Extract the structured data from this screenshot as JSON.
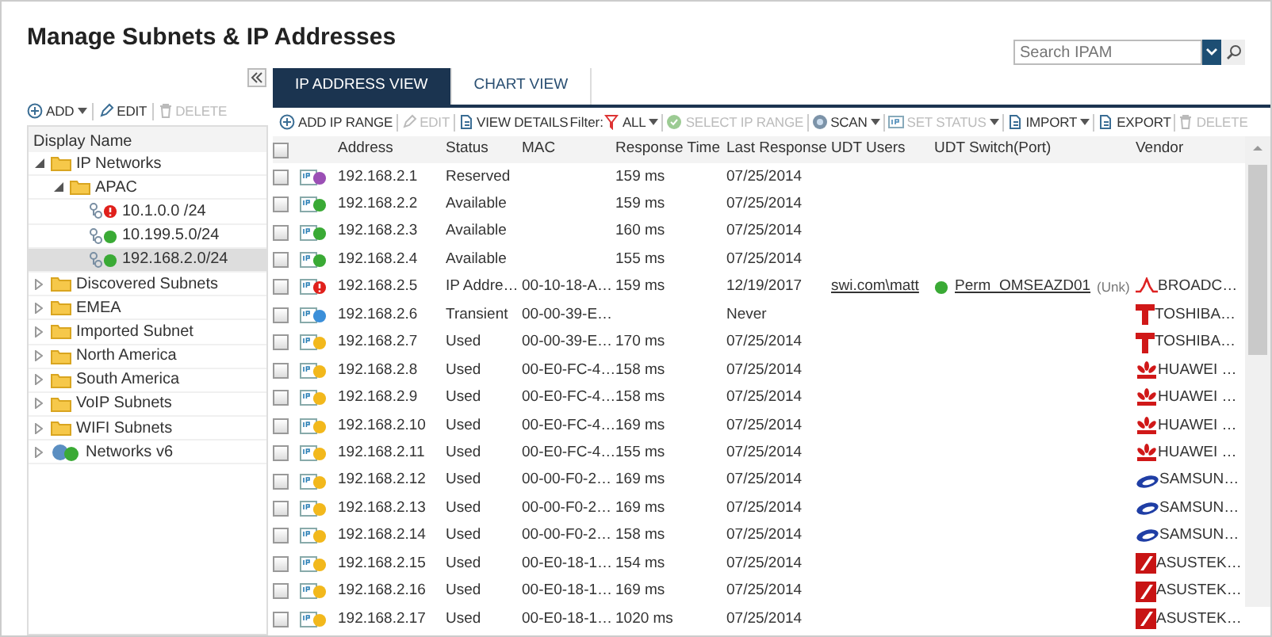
{
  "page_title": "Manage Subnets & IP Addresses",
  "search": {
    "placeholder": "Search IPAM"
  },
  "tree_toolbar": [
    {
      "label": "ADD",
      "dropdown": true,
      "disabled": false
    },
    {
      "label": "EDIT",
      "dropdown": false,
      "disabled": false
    },
    {
      "label": "DELETE",
      "dropdown": false,
      "disabled": true
    }
  ],
  "tree_header": "Display Name",
  "tree": [
    {
      "label": "IP Networks",
      "kind": "folder",
      "expanded": true,
      "selected": false,
      "children": [
        {
          "label": "APAC",
          "kind": "folder",
          "expanded": true,
          "selected": false,
          "children": [
            {
              "label": "10.1.0.0 /24",
              "kind": "subnet",
              "selected": false,
              "color": "#e0201b",
              "alert": true
            },
            {
              "label": "10.199.5.0/24",
              "kind": "subnet",
              "selected": false,
              "color": "#3aaa35",
              "alert": false
            },
            {
              "label": "192.168.2.0/24",
              "kind": "subnet",
              "selected": true,
              "color": "#3aaa35",
              "alert": false
            }
          ]
        }
      ]
    },
    {
      "label": "Discovered Subnets",
      "kind": "folder",
      "expanded": false,
      "selected": false
    },
    {
      "label": "EMEA",
      "kind": "folder",
      "expanded": false,
      "selected": false
    },
    {
      "label": "Imported Subnet",
      "kind": "folder",
      "expanded": false,
      "selected": false
    },
    {
      "label": "North America",
      "kind": "folder",
      "expanded": false,
      "selected": false
    },
    {
      "label": "South America",
      "kind": "folder",
      "expanded": false,
      "selected": false
    },
    {
      "label": "VoIP Subnets",
      "kind": "folder",
      "expanded": false,
      "selected": false
    },
    {
      "label": "WIFI Subnets",
      "kind": "folder",
      "expanded": false,
      "selected": false
    },
    {
      "label": "Networks v6",
      "kind": "globe",
      "expanded": false,
      "selected": false
    }
  ],
  "tabs": [
    {
      "label": "IP ADDRESS VIEW",
      "selected": true
    },
    {
      "label": "CHART VIEW",
      "selected": false
    }
  ],
  "toolbar": [
    {
      "kind": "button",
      "label": "ADD IP RANGE",
      "dropdown": false,
      "disabled": false
    },
    {
      "kind": "button",
      "label": "EDIT",
      "dropdown": false,
      "disabled": true
    },
    {
      "kind": "button",
      "label": "VIEW DETAILS",
      "dropdown": false,
      "disabled": false
    },
    {
      "kind": "label",
      "label": "Filter:"
    },
    {
      "kind": "button",
      "label": "ALL",
      "dropdown": true,
      "disabled": false
    },
    {
      "kind": "button",
      "label": "SELECT IP RANGE",
      "dropdown": false,
      "disabled": true
    },
    {
      "kind": "button",
      "label": "SCAN",
      "dropdown": true,
      "disabled": false
    },
    {
      "kind": "button",
      "label": "SET STATUS",
      "dropdown": true,
      "disabled": true
    },
    {
      "kind": "button",
      "label": "IMPORT",
      "dropdown": true,
      "disabled": false
    },
    {
      "kind": "button",
      "label": "EXPORT",
      "dropdown": false,
      "disabled": false
    },
    {
      "kind": "button",
      "label": "DELETE",
      "dropdown": false,
      "disabled": true
    }
  ],
  "select_all": {
    "checked": false
  },
  "columns": [
    "Address",
    "Status",
    "MAC",
    "Response Time",
    "Last Response",
    "UDT Users",
    "UDT Switch(Port)",
    "Vendor"
  ],
  "rows": [
    {
      "checked": false,
      "color": "#9b4fb5",
      "alert": false,
      "address": "192.168.2.1",
      "status": "Reserved",
      "mac": "",
      "response_time": "159 ms",
      "last_response": "07/25/2014"
    },
    {
      "checked": false,
      "color": "#3aaa35",
      "alert": false,
      "address": "192.168.2.2",
      "status": "Available",
      "mac": "",
      "response_time": "159 ms",
      "last_response": "07/25/2014"
    },
    {
      "checked": false,
      "color": "#3aaa35",
      "alert": false,
      "address": "192.168.2.3",
      "status": "Available",
      "mac": "",
      "response_time": "160 ms",
      "last_response": "07/25/2014"
    },
    {
      "checked": false,
      "color": "#3aaa35",
      "alert": false,
      "address": "192.168.2.4",
      "status": "Available",
      "mac": "",
      "response_time": "155 ms",
      "last_response": "07/25/2014"
    },
    {
      "checked": false,
      "color": "#e0201b",
      "alert": true,
      "address": "192.168.2.5",
      "status": "IP Addre…",
      "mac": "00-10-18-A…",
      "response_time": "159 ms",
      "last_response": "12/19/2017",
      "udt_user": "swi.com\\matt",
      "udt_switch": {
        "name": "Perm_OMSEAZD01",
        "port": "(Unk)",
        "color": "#3aaa35"
      },
      "vendor": {
        "name": "BROADC…",
        "kind": "wave"
      }
    },
    {
      "checked": false,
      "color": "#3b8fd9",
      "alert": false,
      "address": "192.168.2.6",
      "status": "Transient",
      "mac": "00-00-39-E…",
      "response_time": "",
      "last_response": "Never",
      "vendor": {
        "name": "TOSHIBA…",
        "kind": "letter-t"
      }
    },
    {
      "checked": false,
      "color": "#f2b81c",
      "alert": false,
      "address": "192.168.2.7",
      "status": "Used",
      "mac": "00-00-39-E…",
      "response_time": "170 ms",
      "last_response": "07/25/2014",
      "vendor": {
        "name": "TOSHIBA…",
        "kind": "letter-t"
      }
    },
    {
      "checked": false,
      "color": "#f2b81c",
      "alert": false,
      "address": "192.168.2.8",
      "status": "Used",
      "mac": "00-E0-FC-4…",
      "response_time": "158 ms",
      "last_response": "07/25/2014",
      "vendor": {
        "name": "HUAWEI …",
        "kind": "petals"
      }
    },
    {
      "checked": false,
      "color": "#f2b81c",
      "alert": false,
      "address": "192.168.2.9",
      "status": "Used",
      "mac": "00-E0-FC-4…",
      "response_time": "158 ms",
      "last_response": "07/25/2014",
      "vendor": {
        "name": "HUAWEI …",
        "kind": "petals"
      }
    },
    {
      "checked": false,
      "color": "#f2b81c",
      "alert": false,
      "address": "192.168.2.10",
      "status": "Used",
      "mac": "00-E0-FC-4…",
      "response_time": "169 ms",
      "last_response": "07/25/2014",
      "vendor": {
        "name": "HUAWEI …",
        "kind": "petals"
      }
    },
    {
      "checked": false,
      "color": "#f2b81c",
      "alert": false,
      "address": "192.168.2.11",
      "status": "Used",
      "mac": "00-E0-FC-4…",
      "response_time": "155 ms",
      "last_response": "07/25/2014",
      "vendor": {
        "name": "HUAWEI …",
        "kind": "petals"
      }
    },
    {
      "checked": false,
      "color": "#f2b81c",
      "alert": false,
      "address": "192.168.2.12",
      "status": "Used",
      "mac": "00-00-F0-2…",
      "response_time": "169 ms",
      "last_response": "07/25/2014",
      "vendor": {
        "name": "SAMSUN…",
        "kind": "oval"
      }
    },
    {
      "checked": false,
      "color": "#f2b81c",
      "alert": false,
      "address": "192.168.2.13",
      "status": "Used",
      "mac": "00-00-F0-2…",
      "response_time": "169 ms",
      "last_response": "07/25/2014",
      "vendor": {
        "name": "SAMSUN…",
        "kind": "oval"
      }
    },
    {
      "checked": false,
      "color": "#f2b81c",
      "alert": false,
      "address": "192.168.2.14",
      "status": "Used",
      "mac": "00-00-F0-2…",
      "response_time": "158 ms",
      "last_response": "07/25/2014",
      "vendor": {
        "name": "SAMSUN…",
        "kind": "oval"
      }
    },
    {
      "checked": false,
      "color": "#f2b81c",
      "alert": false,
      "address": "192.168.2.15",
      "status": "Used",
      "mac": "00-E0-18-1…",
      "response_time": "154 ms",
      "last_response": "07/25/2014",
      "vendor": {
        "name": "ASUSTEK…",
        "kind": "slash"
      }
    },
    {
      "checked": false,
      "color": "#f2b81c",
      "alert": false,
      "address": "192.168.2.16",
      "status": "Used",
      "mac": "00-E0-18-1…",
      "response_time": "169 ms",
      "last_response": "07/25/2014",
      "vendor": {
        "name": "ASUSTEK…",
        "kind": "slash"
      }
    },
    {
      "checked": false,
      "color": "#f2b81c",
      "alert": false,
      "address": "192.168.2.17",
      "status": "Used",
      "mac": "00-E0-18-1…",
      "response_time": "1020 ms",
      "last_response": "07/25/2014",
      "vendor": {
        "name": "ASUSTEK…",
        "kind": "slash"
      }
    }
  ]
}
